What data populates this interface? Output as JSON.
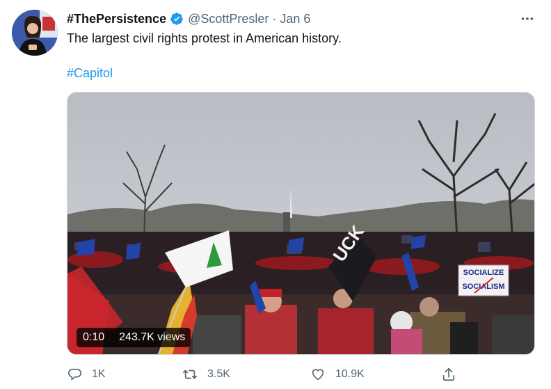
{
  "tweet": {
    "author_name": "#ThePersistence",
    "handle": "@ScottPresler",
    "separator": "·",
    "date": "Jan 6",
    "text": "The largest civil rights protest in American history.",
    "hashtag": "#Capitol"
  },
  "video": {
    "duration": "0:10",
    "views": "243.7K views",
    "sign_text_1": "SOCIALIZE",
    "sign_text_2": "SOCIALISM",
    "banner_text": "UCK"
  },
  "actions": {
    "replies": "1K",
    "retweets": "3.5K",
    "likes": "10.9K"
  },
  "icons": [
    "verified-badge-icon",
    "more-options-icon",
    "reply-icon",
    "retweet-icon",
    "like-icon",
    "share-icon"
  ],
  "colors": {
    "accent": "#1d9bf0",
    "text": "#0f1419",
    "muted": "#536471"
  }
}
